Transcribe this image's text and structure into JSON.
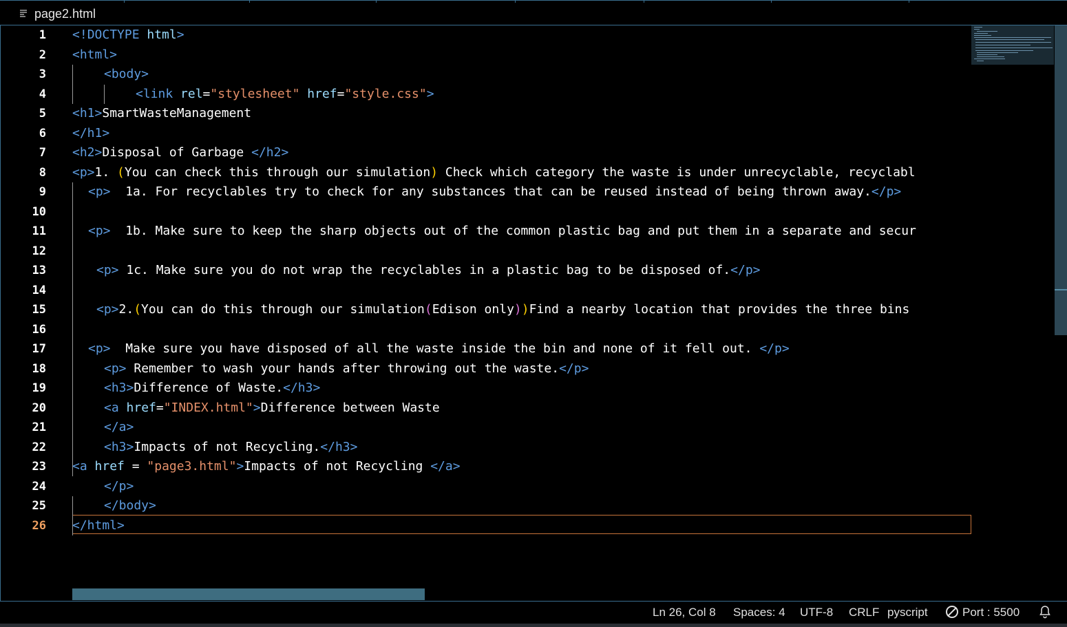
{
  "tab": {
    "filename": "page2.html",
    "icon": "file-lines-icon"
  },
  "lines": [
    {
      "n": "1"
    },
    {
      "n": "2"
    },
    {
      "n": "3"
    },
    {
      "n": "4"
    },
    {
      "n": "5"
    },
    {
      "n": "6"
    },
    {
      "n": "7"
    },
    {
      "n": "8"
    },
    {
      "n": "9"
    },
    {
      "n": "10"
    },
    {
      "n": "11"
    },
    {
      "n": "12"
    },
    {
      "n": "13"
    },
    {
      "n": "14"
    },
    {
      "n": "15"
    },
    {
      "n": "16"
    },
    {
      "n": "17"
    },
    {
      "n": "18"
    },
    {
      "n": "19"
    },
    {
      "n": "20"
    },
    {
      "n": "21"
    },
    {
      "n": "22"
    },
    {
      "n": "23"
    },
    {
      "n": "24"
    },
    {
      "n": "25"
    },
    {
      "n": "26"
    }
  ],
  "code": {
    "l1_a": "<!",
    "l1_b": "DOCTYPE",
    "l1_c": " html",
    "l1_d": ">",
    "l2": "<html>",
    "l3": "<body>",
    "l4_a": "<link",
    "l4_b": " rel",
    "l4_c": "=",
    "l4_d": "\"stylesheet\"",
    "l4_e": " href",
    "l4_f": "=",
    "l4_g": "\"style.css\"",
    "l4_h": ">",
    "l5_a": "<h1>",
    "l5_b": "SmartWasteManagement",
    "l6": "</h1>",
    "l7_a": "<h2>",
    "l7_b": "Disposal of Garbage ",
    "l7_c": "</h2>",
    "l8_a": "<p>",
    "l8_b": "1. ",
    "l8_c": "(",
    "l8_d": "You can check this through our simulation",
    "l8_e": ")",
    "l8_f": " Check which category the waste is under unrecyclable, recyclabl",
    "l9_a": "<p>",
    "l9_b": "  1a. For recyclables try to check for any substances that can be reused instead of being thrown away.",
    "l9_c": "</p>",
    "l11_a": "<p>",
    "l11_b": "  1b. Make sure to keep the sharp objects out of the common plastic bag and put them in a separate and secur",
    "l13_a": "<p>",
    "l13_b": " 1c. Make sure you do not wrap the recyclables in a plastic bag to be disposed of.",
    "l13_c": "</p>",
    "l15_a": "<p>",
    "l15_b": "2.",
    "l15_c": "(",
    "l15_d": "You can do this through our simulation",
    "l15_e": "(",
    "l15_f": "Edison only",
    "l15_g": ")",
    "l15_h": ")",
    "l15_i": "Find a nearby location that provides the three bins ",
    "l17_a": "<p>",
    "l17_b": "  Make sure you have disposed of all the waste inside the bin and none of it fell out. ",
    "l17_c": "</p>",
    "l18_a": "<p>",
    "l18_b": " Remember to wash your hands after throwing out the waste.",
    "l18_c": "</p>",
    "l19_a": "<h3>",
    "l19_b": "Difference of Waste.",
    "l19_c": "</h3>",
    "l20_a": "<a",
    "l20_b": " href",
    "l20_c": "=",
    "l20_d": "\"INDEX.html\"",
    "l20_e": ">",
    "l20_f": "Difference between Waste",
    "l21": "</a>",
    "l22_a": "<h3>",
    "l22_b": "Impacts of not Recycling.",
    "l22_c": "</h3>",
    "l23_a": "<a",
    "l23_b": " href",
    "l23_c": " = ",
    "l23_d": "\"page3.html\"",
    "l23_e": ">",
    "l23_f": "Impacts of not Recycling ",
    "l23_g": "</a>",
    "l24": "</p>",
    "l25": "</body>",
    "l26": "</html>"
  },
  "status": {
    "position": "Ln 26, Col 8",
    "spaces": "Spaces: 4",
    "encoding": "UTF-8",
    "eol": "CRLF",
    "language": "pyscript",
    "port": "Port : 5500",
    "port_icon": "circle-slash-icon",
    "bell_icon": "bell-icon"
  },
  "colors": {
    "tag": "#5e9ce0",
    "attribute": "#9cdcfe",
    "string": "#e5906a",
    "bracket_yellow": "#ffd000",
    "bracket_pink": "#da70d6",
    "current_line_border": "#c8743a",
    "panel_border": "#3a6e8f"
  }
}
